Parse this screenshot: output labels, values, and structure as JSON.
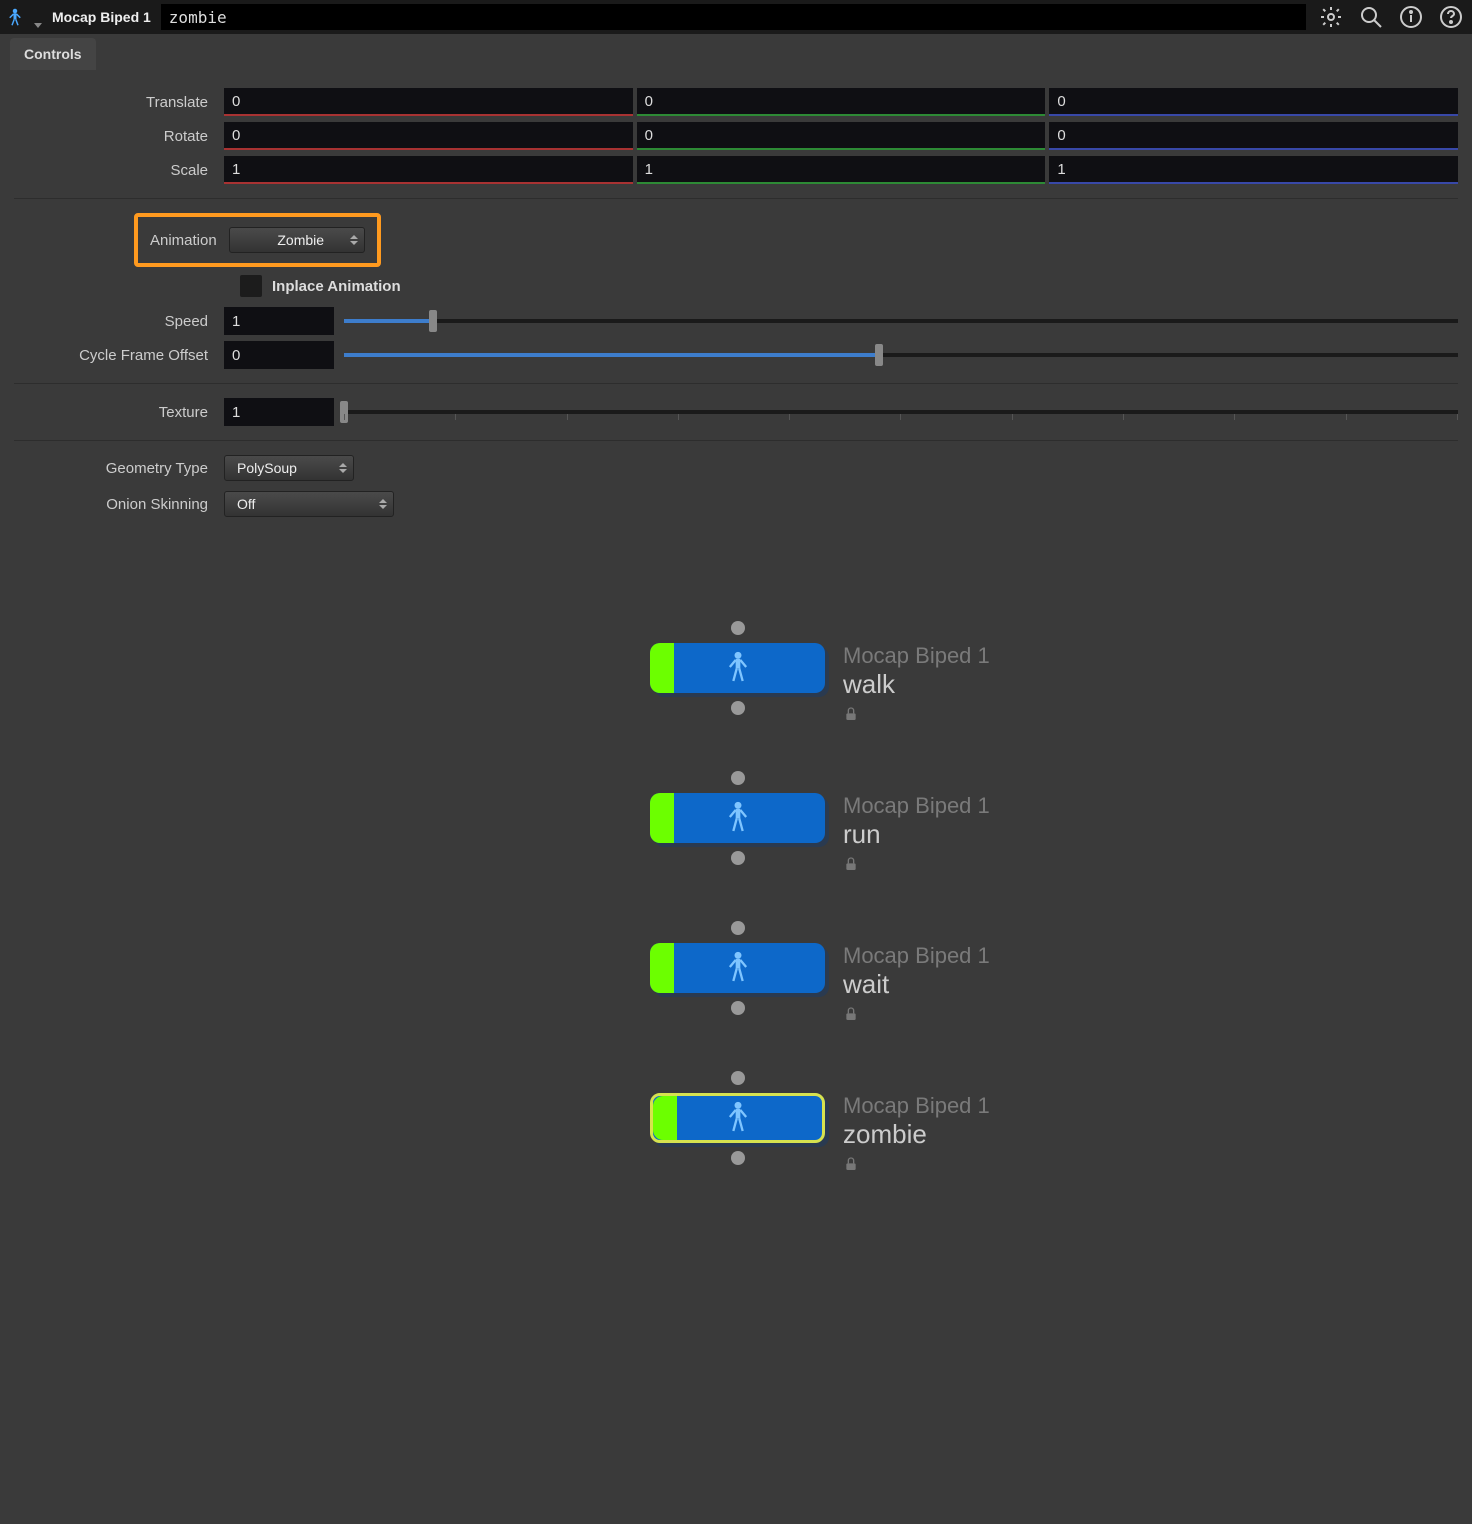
{
  "header": {
    "title": "Mocap Biped 1",
    "name_value": "zombie"
  },
  "tabs": {
    "controls": "Controls"
  },
  "transform": {
    "translate_label": "Translate",
    "translate": [
      "0",
      "0",
      "0"
    ],
    "rotate_label": "Rotate",
    "rotate": [
      "0",
      "0",
      "0"
    ],
    "scale_label": "Scale",
    "scale": [
      "1",
      "1",
      "1"
    ]
  },
  "animation": {
    "label": "Animation",
    "selected": "Zombie",
    "inplace_label": "Inplace Animation",
    "inplace_checked": false,
    "speed_label": "Speed",
    "speed_value": "1",
    "cfo_label": "Cycle Frame Offset",
    "cfo_value": "0"
  },
  "texture": {
    "label": "Texture",
    "value": "1"
  },
  "geometry": {
    "label": "Geometry Type",
    "selected": "PolySoup"
  },
  "onion": {
    "label": "Onion Skinning",
    "selected": "Off"
  },
  "nodes": [
    {
      "type": "Mocap Biped 1",
      "name": "walk",
      "selected": false
    },
    {
      "type": "Mocap Biped 1",
      "name": "run",
      "selected": false
    },
    {
      "type": "Mocap Biped 1",
      "name": "wait",
      "selected": false
    },
    {
      "type": "Mocap Biped 1",
      "name": "zombie",
      "selected": true
    }
  ]
}
